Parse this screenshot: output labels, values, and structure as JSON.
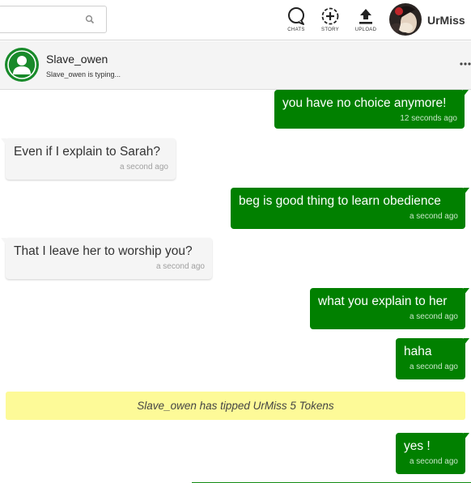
{
  "search": {
    "value": "",
    "placeholder": ""
  },
  "nav": {
    "chats_label": "CHATS",
    "story_label": "STORY",
    "upload_label": "UPLOAD"
  },
  "user": {
    "name": "UrMiss"
  },
  "chat": {
    "contact_name": "Slave_owen",
    "status": "Slave_owen is typing..."
  },
  "messages": [
    {
      "direction": "out",
      "text": "you have no choice anymore!",
      "time": "12 seconds ago"
    },
    {
      "direction": "in",
      "text": "Even if I explain to Sarah?",
      "time": "a second ago"
    },
    {
      "direction": "out",
      "text": "beg is good thing to learn obedience",
      "time": "a second ago"
    },
    {
      "direction": "in",
      "text": "That I leave her to worship you?",
      "time": "a second ago"
    },
    {
      "direction": "out",
      "text": "what you explain to her",
      "time": "a second ago"
    },
    {
      "direction": "out",
      "text": "haha",
      "time": "a second ago"
    },
    {
      "direction": "out",
      "text": "yes !",
      "time": "a second ago"
    }
  ],
  "tip_notice": "Slave_owen has tipped UrMiss 5 Tokens",
  "colors": {
    "outgoing_bubble": "#018000",
    "incoming_bubble": "#f5f5f5",
    "tip_banner": "#fdfa98",
    "contact_avatar": "#188a2a"
  },
  "icons": [
    "search-icon",
    "chat-bubble-icon",
    "add-story-icon",
    "upload-icon",
    "more-options-icon",
    "default-user-icon"
  ]
}
